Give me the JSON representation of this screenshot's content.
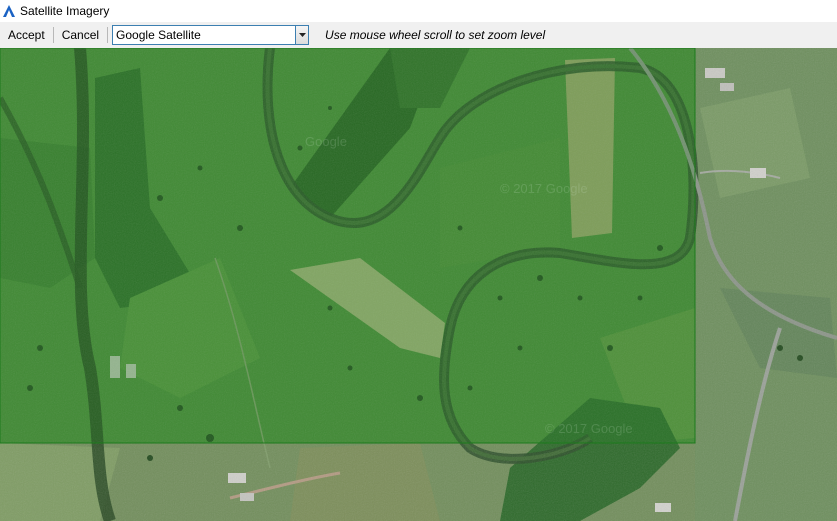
{
  "window": {
    "title": "Satellite Imagery",
    "icon": "app-logo-icon"
  },
  "toolbar": {
    "accept_label": "Accept",
    "cancel_label": "Cancel",
    "provider": {
      "selected": "Google Satellite"
    },
    "hint": "Use mouse wheel scroll to set zoom level"
  },
  "map": {
    "watermark": "© 2017 Google",
    "watermark_short": "Google",
    "overlay_color": "#1e8a1e"
  }
}
